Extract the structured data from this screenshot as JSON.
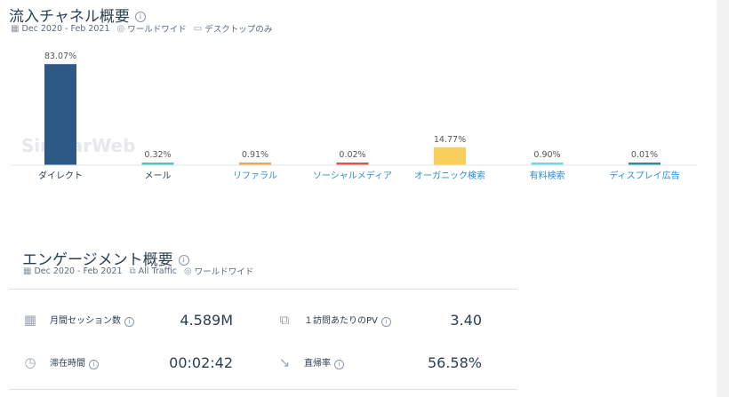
{
  "traffic": {
    "title": "流入チャネル概要",
    "meta": {
      "date_range": "Dec 2020 - Feb 2021",
      "region": "ワールドワイド",
      "device": "デスクトップのみ"
    },
    "watermark": "SimilarWeb"
  },
  "chart_data": {
    "type": "bar",
    "categories": [
      "ダイレクト",
      "メール",
      "リファラル",
      "ソーシャルメディア",
      "オーガニック検索",
      "有料検索",
      "ディスプレイ広告"
    ],
    "values": [
      83.07,
      0.32,
      0.91,
      0.02,
      14.77,
      0.9,
      0.01
    ],
    "value_labels": [
      "83.07%",
      "0.32%",
      "0.91%",
      "0.02%",
      "14.77%",
      "0.90%",
      "0.01%"
    ],
    "link_categories": [
      false,
      false,
      true,
      true,
      true,
      true,
      true
    ],
    "colors": [
      "#2e5987",
      "#4fc7c0",
      "#f3a64f",
      "#e0524f",
      "#f9cf5b",
      "#6fd7ea",
      "#2e8f94"
    ],
    "ylim": [
      0,
      100
    ]
  },
  "engagement": {
    "title": "エンゲージメント概要",
    "meta": {
      "date_range": "Dec 2020 - Feb 2021",
      "traffic": "All Traffic",
      "region": "ワールドワイド"
    },
    "metrics": [
      {
        "label": "月間セッション数",
        "value": "4.589M",
        "icon": "calendar-icon"
      },
      {
        "label": "１訪問あたりのPV",
        "value": "3.40",
        "icon": "pages-icon"
      },
      {
        "label": "滞在時間",
        "value": "00:02:42",
        "icon": "stopwatch-icon"
      },
      {
        "label": "直帰率",
        "value": "56.58%",
        "icon": "bounce-arrow-icon"
      }
    ]
  }
}
